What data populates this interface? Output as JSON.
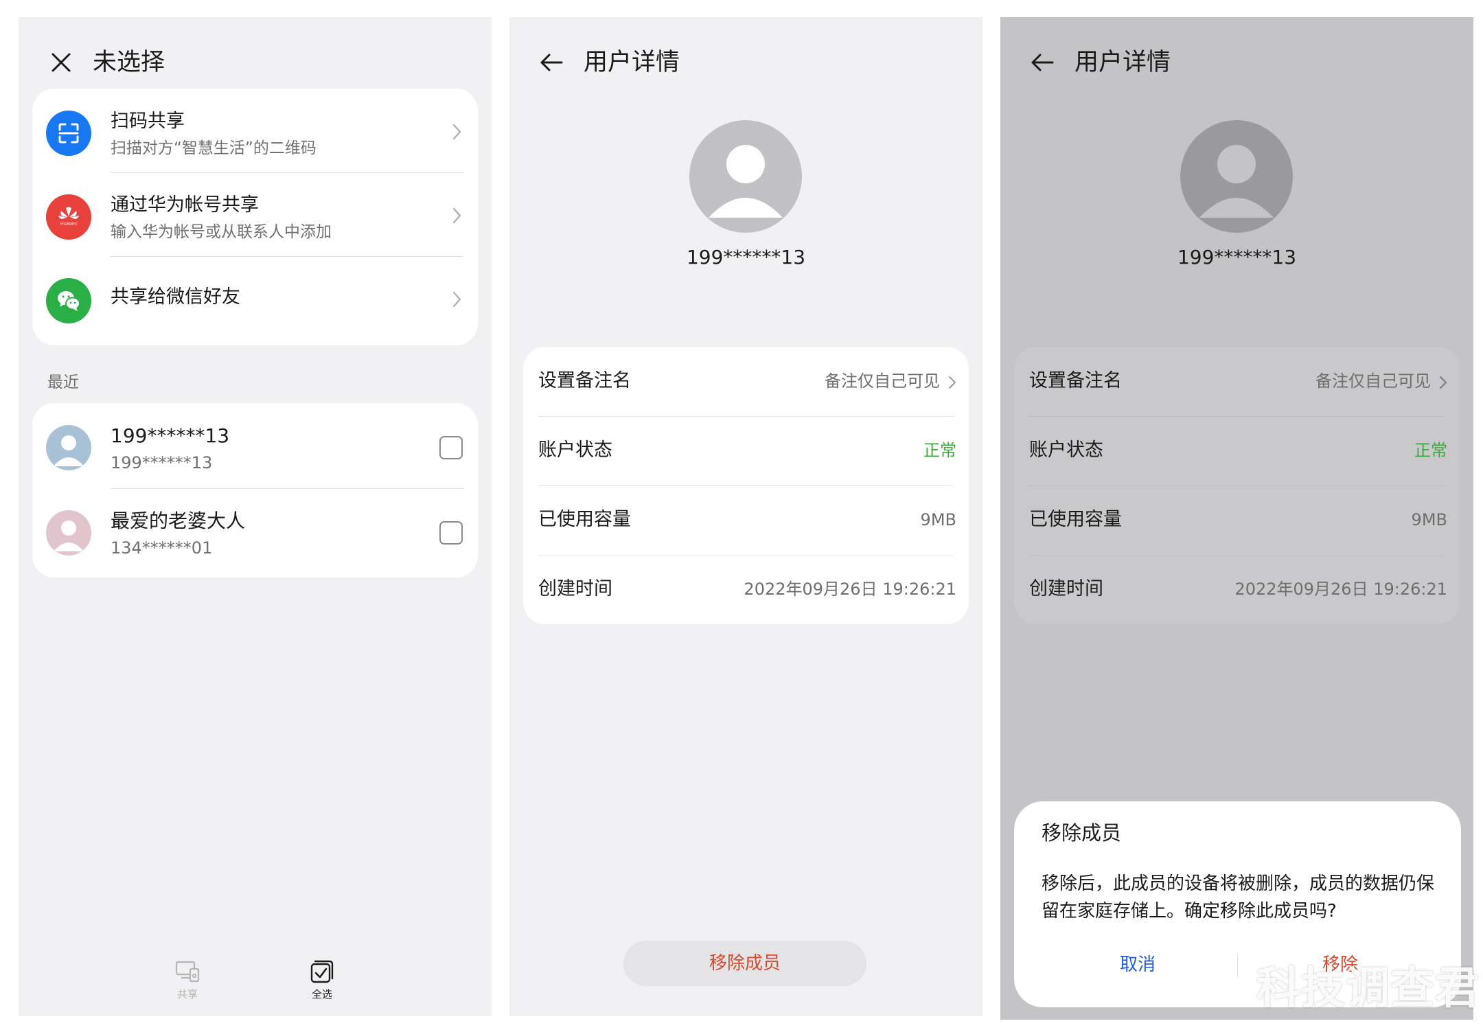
{
  "panel1": {
    "header": {
      "title": "未选择",
      "icon": "close-icon"
    },
    "share_options": [
      {
        "title": "扫码共享",
        "subtitle": "扫描对方“智慧生活”的二维码",
        "icon": "scan-qr-icon",
        "color": "#1877f2"
      },
      {
        "title": "通过华为帐号共享",
        "subtitle": "输入华为帐号或从联系人中添加",
        "icon": "huawei-logo-icon",
        "color": "#e8403a"
      },
      {
        "title": "共享给微信好友",
        "subtitle": "",
        "icon": "wechat-icon",
        "color": "#2aae46"
      }
    ],
    "recent_label": "最近",
    "contacts": [
      {
        "name": "199******13",
        "number": "199******13",
        "avatar_color": "#a9c1d6"
      },
      {
        "name": "最爱的老婆大人",
        "number": "134******01",
        "avatar_color": "#e2c4cd"
      }
    ],
    "bottom_nav": [
      {
        "label": "共享",
        "icon": "share-devices-icon",
        "enabled": false
      },
      {
        "label": "全选",
        "icon": "select-all-icon",
        "enabled": true
      }
    ]
  },
  "panel2": {
    "header": {
      "title": "用户详情",
      "icon": "back-arrow-icon"
    },
    "user_id": "199******13",
    "details": [
      {
        "label": "设置备注名",
        "value": "备注仅自己可见"
      },
      {
        "label": "账户状态",
        "value": "正常"
      },
      {
        "label": "已使用容量",
        "value": "9MB"
      },
      {
        "label": "创建时间",
        "value": "2022年09月26日 19:26:21"
      }
    ],
    "remove_button": "移除成员"
  },
  "panel3": {
    "header": {
      "title": "用户详情",
      "icon": "back-arrow-icon"
    },
    "user_id": "199******13",
    "details": [
      {
        "label": "设置备注名",
        "value": "备注仅自己可见"
      },
      {
        "label": "账户状态",
        "value": "正常"
      },
      {
        "label": "已使用容量",
        "value": "9MB"
      },
      {
        "label": "创建时间",
        "value": "2022年09月26日 19:26:21"
      }
    ],
    "dialog": {
      "title": "移除成员",
      "message": "移除后，此成员的设备将被删除，成员的数据仍保留在家庭存储上。确定移除此成员吗?",
      "cancel": "取消",
      "confirm": "移除"
    }
  },
  "watermark": "科技调查君",
  "colors": {
    "accent_blue": "#1f5ed6",
    "danger": "#d64a2d",
    "ok_green": "#3ea83e",
    "panel_bg": "#f1f1f3",
    "dim_bg": "#c4c4c6"
  }
}
